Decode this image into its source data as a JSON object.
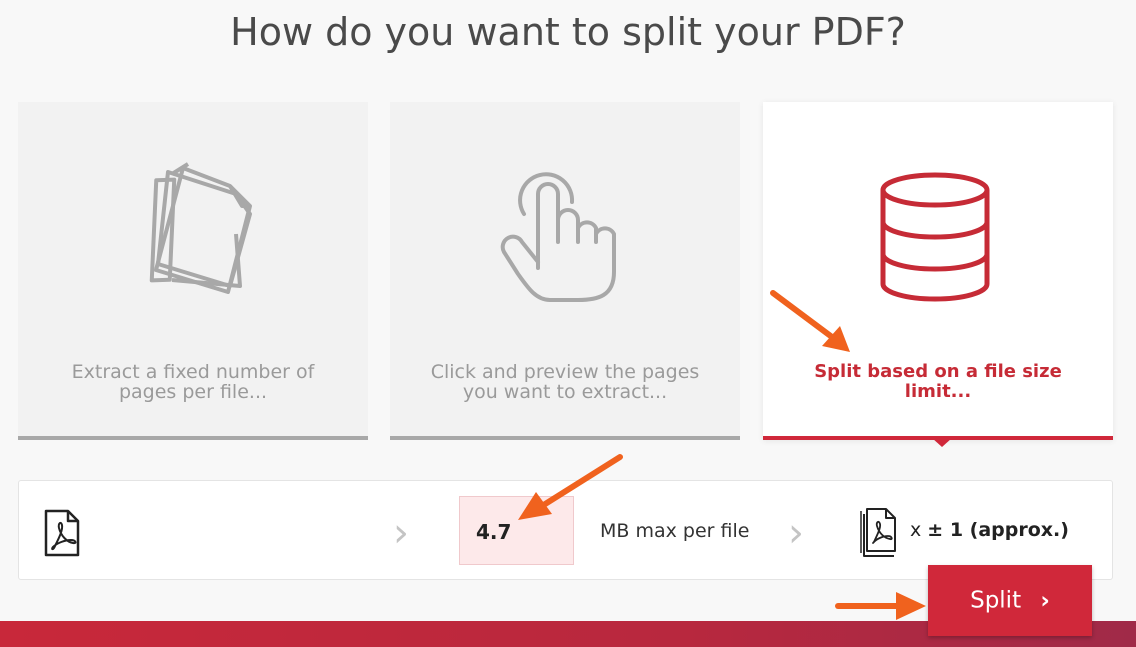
{
  "page": {
    "title": "How do you want to split your PDF?"
  },
  "options": [
    {
      "label": "Extract a fixed number of pages per file...",
      "icon": "pages-stack-icon",
      "selected": false
    },
    {
      "label": "Click and preview the pages you want to extract...",
      "icon": "hand-pointer-icon",
      "selected": false
    },
    {
      "label": "Split based on a file size limit...",
      "icon": "database-icon",
      "selected": true
    }
  ],
  "settings": {
    "size_value": "4.7",
    "unit_label": "MB max per file",
    "result_prefix": "x",
    "result_value": "± 1 (approx.)"
  },
  "actions": {
    "split_label": "Split"
  },
  "colors": {
    "accent": "#d0283a",
    "arrow": "#f0621e",
    "muted": "#a8a8a8"
  }
}
